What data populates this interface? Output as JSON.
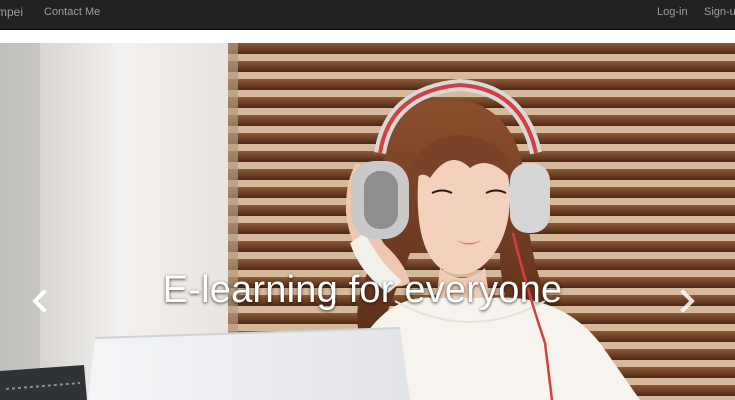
{
  "navbar": {
    "brand": "mpei",
    "links": {
      "contact": "Contact Me"
    },
    "right": {
      "login": "Log-in",
      "signup": "Sign-up"
    }
  },
  "carousel": {
    "caption": "E-learning for everyone",
    "image_alt": "Woman with headphones studying at a laptop",
    "controls": {
      "prev_icon": "chevron-left-icon",
      "next_icon": "chevron-right-icon"
    }
  },
  "colors": {
    "navbar_bg": "#222222",
    "nav_text": "#9d9d9d",
    "caption": "#ffffff"
  }
}
